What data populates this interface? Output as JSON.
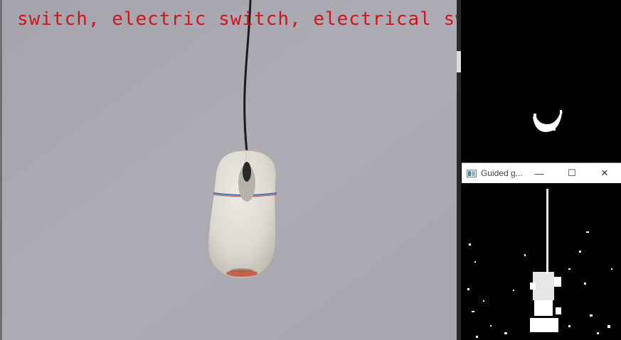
{
  "camera": {
    "overlay_text": "switch, electric switch, electrical sw"
  },
  "guided_window": {
    "title": "Guided g...",
    "minimize_glyph": "—",
    "maximize_glyph": "☐",
    "close_glyph": "✕"
  },
  "colors": {
    "overlay_text": "#d2141e",
    "background_wall": "#a9a8b0",
    "mask": "#ffffff"
  }
}
